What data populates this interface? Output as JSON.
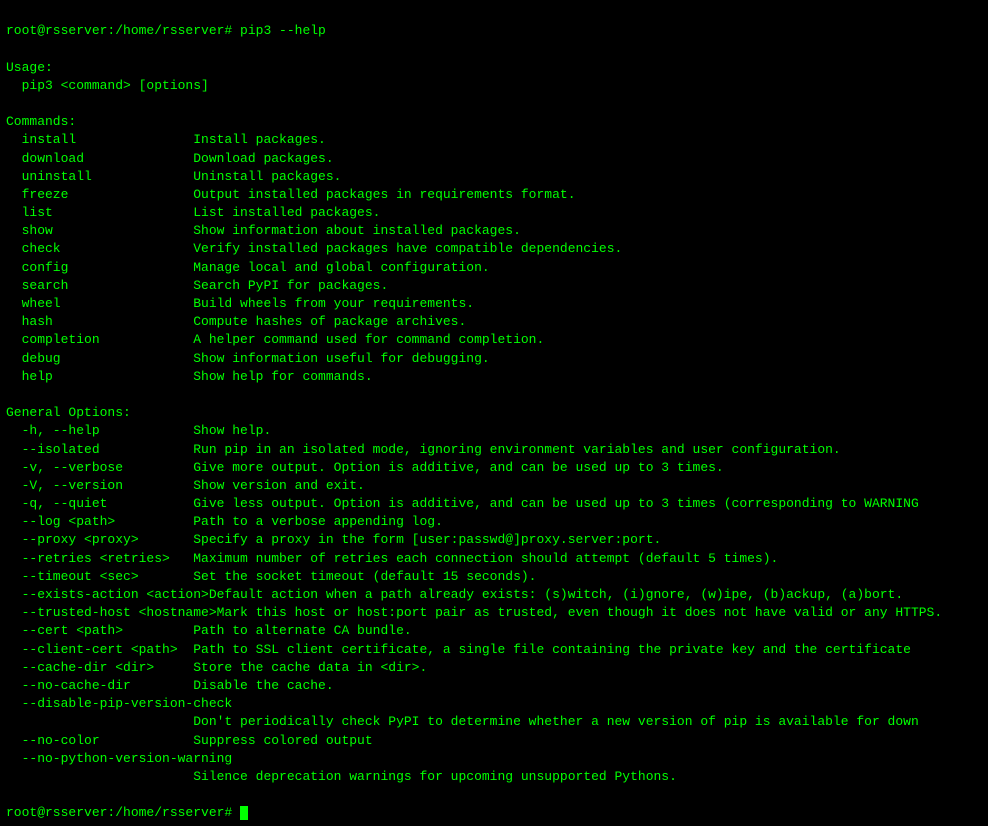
{
  "terminal": {
    "prompt_top": "root@rsserver:/home/rsserver# pip3 --help",
    "usage_header": "Usage:",
    "usage_line": "  pip3 <command> [options]",
    "commands_header": "Commands:",
    "commands": [
      {
        "name": "  install",
        "desc": "Install packages."
      },
      {
        "name": "  download",
        "desc": "Download packages."
      },
      {
        "name": "  uninstall",
        "desc": "Uninstall packages."
      },
      {
        "name": "  freeze",
        "desc": "Output installed packages in requirements format."
      },
      {
        "name": "  list",
        "desc": "List installed packages."
      },
      {
        "name": "  show",
        "desc": "Show information about installed packages."
      },
      {
        "name": "  check",
        "desc": "Verify installed packages have compatible dependencies."
      },
      {
        "name": "  config",
        "desc": "Manage local and global configuration."
      },
      {
        "name": "  search",
        "desc": "Search PyPI for packages."
      },
      {
        "name": "  wheel",
        "desc": "Build wheels from your requirements."
      },
      {
        "name": "  hash",
        "desc": "Compute hashes of package archives."
      },
      {
        "name": "  completion",
        "desc": "A helper command used for command completion."
      },
      {
        "name": "  debug",
        "desc": "Show information useful for debugging."
      },
      {
        "name": "  help",
        "desc": "Show help for commands."
      }
    ],
    "general_header": "General Options:",
    "options": [
      {
        "name": "  -h, --help",
        "desc": "Show help."
      },
      {
        "name": "  --isolated",
        "desc": "Run pip in an isolated mode, ignoring environment variables and user configuration."
      },
      {
        "name": "  -v, --verbose",
        "desc": "Give more output. Option is additive, and can be used up to 3 times."
      },
      {
        "name": "  -V, --version",
        "desc": "Show version and exit."
      },
      {
        "name": "  -q, --quiet",
        "desc": "Give less output. Option is additive, and can be used up to 3 times (corresponding to WARNING"
      },
      {
        "name": "  --log <path>",
        "desc": "Path to a verbose appending log."
      },
      {
        "name": "  --proxy <proxy>",
        "desc": "Specify a proxy in the form [user:passwd@]proxy.server:port."
      },
      {
        "name": "  --retries <retries>",
        "desc": "Maximum number of retries each connection should attempt (default 5 times)."
      },
      {
        "name": "  --timeout <sec>",
        "desc": "Set the socket timeout (default 15 seconds)."
      },
      {
        "name": "  --exists-action <action>",
        "desc": "Default action when a path already exists: (s)witch, (i)gnore, (w)ipe, (b)ackup, (a)bort."
      },
      {
        "name": "  --trusted-host <hostname>",
        "desc": "Mark this host or host:port pair as trusted, even though it does not have valid or any HTTPS."
      },
      {
        "name": "  --cert <path>",
        "desc": "Path to alternate CA bundle."
      },
      {
        "name": "  --client-cert <path>",
        "desc": "Path to SSL client certificate, a single file containing the private key and the certificate"
      },
      {
        "name": "  --cache-dir <dir>",
        "desc": "Store the cache data in <dir>."
      },
      {
        "name": "  --no-cache-dir",
        "desc": "Disable the cache."
      },
      {
        "name": "  --disable-pip-version-check",
        "desc": ""
      },
      {
        "name": "",
        "desc": "Don't periodically check PyPI to determine whether a new version of pip is available for down"
      },
      {
        "name": "  --no-color",
        "desc": "Suppress colored output"
      },
      {
        "name": "  --no-python-version-warning",
        "desc": ""
      },
      {
        "name": "",
        "desc": "Silence deprecation warnings for upcoming unsupported Pythons."
      }
    ],
    "prompt_bottom": "root@rsserver:/home/rsserver# "
  }
}
